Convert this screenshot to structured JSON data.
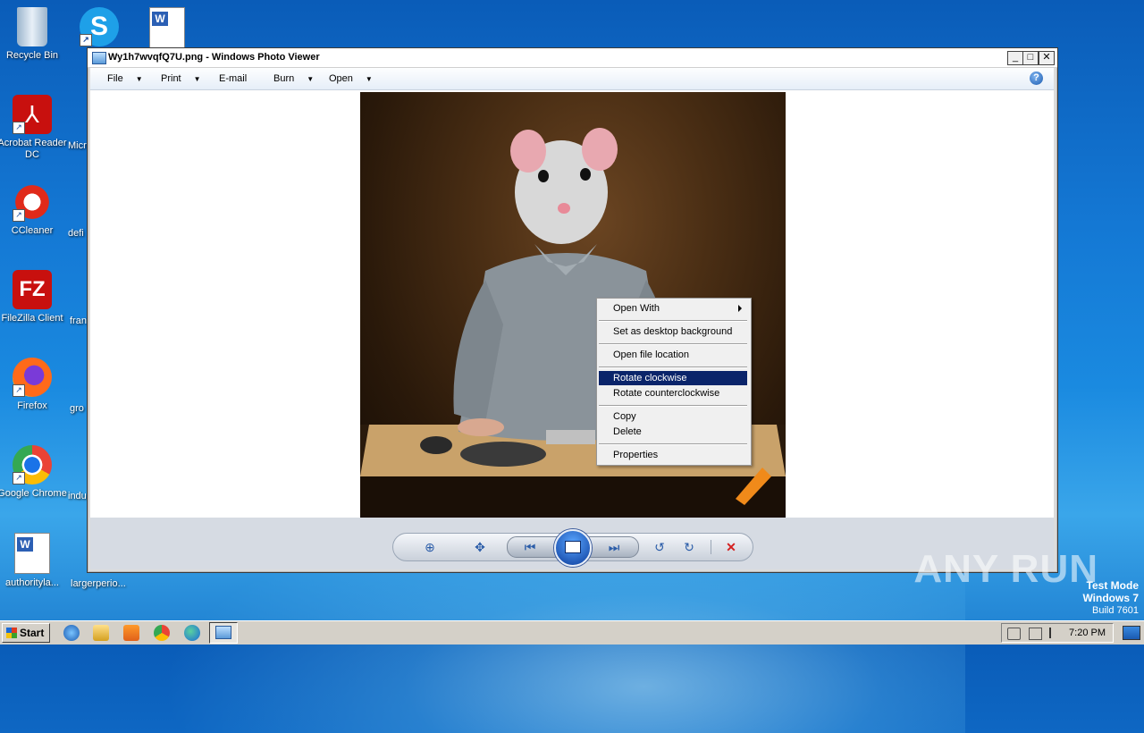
{
  "desktop": {
    "icons": [
      {
        "label": "Recycle Bin",
        "icon": "recycle-bin-icon"
      },
      {
        "label": "Acrobat Reader DC",
        "icon": "acrobat-icon"
      },
      {
        "label": "CCleaner",
        "icon": "ccleaner-icon"
      },
      {
        "label": "FileZilla Client",
        "icon": "filezilla-icon"
      },
      {
        "label": "Firefox",
        "icon": "firefox-icon"
      },
      {
        "label": "Google Chrome",
        "icon": "chrome-icon"
      },
      {
        "label": "authorityla...",
        "icon": "word-doc-icon"
      }
    ],
    "partial_labels": [
      "Micr",
      "defi",
      "fran",
      "gro",
      "indu",
      "largerperio..."
    ]
  },
  "window": {
    "title": "Wy1h7wvqfQ7U.png - Windows Photo Viewer",
    "min": "_",
    "max": "□",
    "close": "✕",
    "menu": [
      "File",
      "Print",
      "E-mail",
      "Burn",
      "Open"
    ],
    "help": "?",
    "image_alt": "painting of a white rat in a grey shirt at a table"
  },
  "context_menu": {
    "items": [
      {
        "label": "Open With",
        "submenu": true
      },
      {
        "label": "Set as desktop background"
      },
      {
        "label": "Open file location"
      },
      {
        "label": "Rotate clockwise",
        "selected": true
      },
      {
        "label": "Rotate counterclockwise"
      },
      {
        "label": "Copy"
      },
      {
        "label": "Delete"
      },
      {
        "label": "Properties"
      }
    ]
  },
  "controls": {
    "zoom": "⊕",
    "fit": "✥",
    "prev": "⏮",
    "next": "⏭",
    "rotate_ccw": "↺",
    "rotate_cw": "↻",
    "delete": "✕"
  },
  "taskbar": {
    "start": "Start",
    "clock": "7:20 PM"
  },
  "overlay": {
    "watermark": "ANY RUN",
    "test_mode": "Test Mode",
    "os": "Windows 7",
    "build": "Build 7601"
  },
  "colors": {
    "selection": "#0a246a",
    "desktop": "#1478d4"
  }
}
